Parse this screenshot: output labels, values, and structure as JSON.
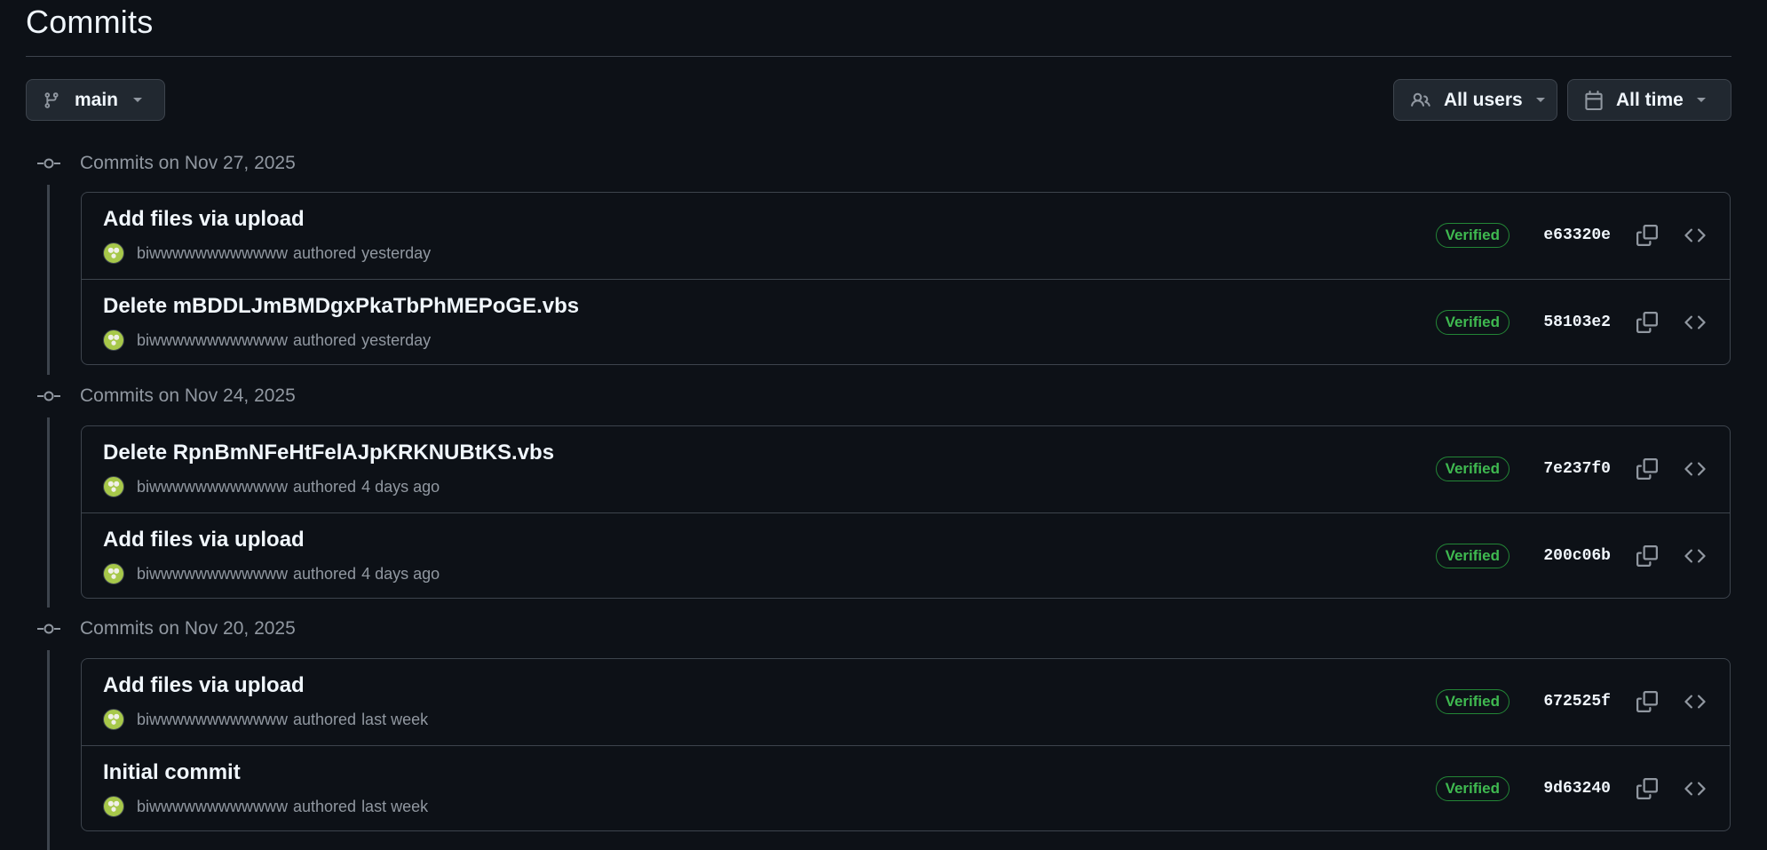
{
  "page_title": "Commits",
  "filters": {
    "branch": "main",
    "users": "All users",
    "time": "All time"
  },
  "colors": {
    "background": "#0d1117",
    "border": "#3d444d",
    "verified": "#3fb950",
    "muted_text": "#9198a1"
  },
  "icons": {
    "branch": "git-branch-icon",
    "users": "people-icon",
    "time": "calendar-icon",
    "caret": "triangle-down-icon",
    "commit": "git-commit-icon",
    "copy": "copy-icon",
    "browse": "code-icon"
  },
  "groups": [
    {
      "label": "Commits on Nov 27, 2025",
      "commits": [
        {
          "message": "Add files via upload",
          "author": "biwwwwwwwwwwww",
          "authored": "authored",
          "time": "yesterday",
          "badge": "Verified",
          "sha": "e63320e"
        },
        {
          "message": "Delete mBDDLJmBMDgxPkaTbPhMEPoGE.vbs",
          "author": "biwwwwwwwwwwww",
          "authored": "authored",
          "time": "yesterday",
          "badge": "Verified",
          "sha": "58103e2"
        }
      ]
    },
    {
      "label": "Commits on Nov 24, 2025",
      "commits": [
        {
          "message": "Delete RpnBmNFeHtFelAJpKRKNUBtKS.vbs",
          "author": "biwwwwwwwwwwww",
          "authored": "authored",
          "time": "4 days ago",
          "badge": "Verified",
          "sha": "7e237f0"
        },
        {
          "message": "Add files via upload",
          "author": "biwwwwwwwwwwww",
          "authored": "authored",
          "time": "4 days ago",
          "badge": "Verified",
          "sha": "200c06b"
        }
      ]
    },
    {
      "label": "Commits on Nov 20, 2025",
      "commits": [
        {
          "message": "Add files via upload",
          "author": "biwwwwwwwwwwww",
          "authored": "authored",
          "time": "last week",
          "badge": "Verified",
          "sha": "672525f"
        },
        {
          "message": "Initial commit",
          "author": "biwwwwwwwwwwww",
          "authored": "authored",
          "time": "last week",
          "badge": "Verified",
          "sha": "9d63240"
        }
      ]
    }
  ]
}
